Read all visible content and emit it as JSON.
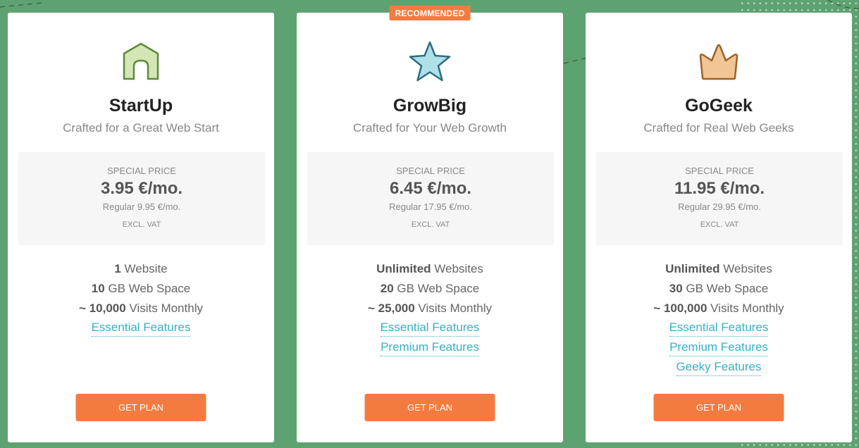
{
  "colors": {
    "background": "#5fa271",
    "accent": "#f47b3f",
    "link": "#36b0c8"
  },
  "plans": [
    {
      "icon": "house-icon",
      "name": "StartUp",
      "tagline": "Crafted for a Great Web Start",
      "special_label": "SPECIAL PRICE",
      "price": "3.95 €/mo.",
      "regular": "Regular 9.95 €/mo.",
      "vat": "EXCL. VAT",
      "features": [
        {
          "bold": "1",
          "text": " Website"
        },
        {
          "bold": "10",
          "text": " GB Web Space"
        },
        {
          "bold": "~ 10,000",
          "text": " Visits Monthly"
        }
      ],
      "links": [
        "Essential Features"
      ],
      "cta": "GET PLAN"
    },
    {
      "badge": "RECOMMENDED",
      "icon": "star-icon",
      "name": "GrowBig",
      "tagline": "Crafted for Your Web Growth",
      "special_label": "SPECIAL PRICE",
      "price": "6.45 €/mo.",
      "regular": "Regular 17.95 €/mo.",
      "vat": "EXCL. VAT",
      "features": [
        {
          "bold": "Unlimited",
          "text": " Websites"
        },
        {
          "bold": "20",
          "text": " GB Web Space"
        },
        {
          "bold": "~ 25,000",
          "text": " Visits Monthly"
        }
      ],
      "links": [
        "Essential Features",
        "Premium Features"
      ],
      "cta": "GET PLAN"
    },
    {
      "icon": "crown-icon",
      "name": "GoGeek",
      "tagline": "Crafted for Real Web Geeks",
      "special_label": "SPECIAL PRICE",
      "price": "11.95 €/mo.",
      "regular": "Regular 29.95 €/mo.",
      "vat": "EXCL. VAT",
      "features": [
        {
          "bold": "Unlimited",
          "text": " Websites"
        },
        {
          "bold": "30",
          "text": " GB Web Space"
        },
        {
          "bold": "~ 100,000",
          "text": " Visits Monthly"
        }
      ],
      "links": [
        "Essential Features",
        "Premium Features",
        "Geeky Features"
      ],
      "cta": "GET PLAN"
    }
  ]
}
